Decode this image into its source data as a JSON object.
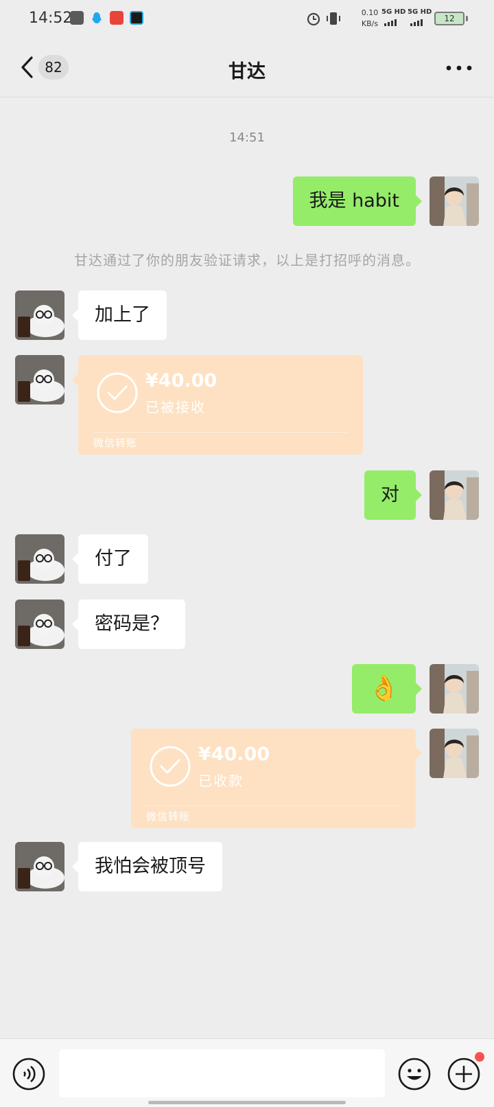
{
  "status_bar": {
    "time": "14:52",
    "net_speed": "0.10",
    "net_unit": "KB/s",
    "sim1": "5G HD",
    "sim2": "5G HD",
    "battery": "12"
  },
  "nav": {
    "unread_count": "82",
    "title": "甘达"
  },
  "chat": {
    "timestamp": "14:51",
    "msg_intro": "我是 habit",
    "system_note": "甘达通过了你的朋友验证请求，以上是打招呼的消息。",
    "msg_added": "加上了",
    "transfer_received": {
      "amount": "¥40.00",
      "status": "已被接收",
      "footer": "微信转账"
    },
    "msg_yes": "对",
    "msg_paid": "付了",
    "msg_password": "密码是？",
    "msg_ok_emoji": "👌",
    "transfer_collected": {
      "amount": "¥40.00",
      "status": "已收款",
      "footer": "微信转账"
    },
    "msg_worry": "我怕会被顶号"
  },
  "input": {
    "value": "",
    "placeholder": ""
  },
  "colors": {
    "background": "#ededed",
    "bubble_sent": "#95ec69",
    "bubble_received": "#ffffff",
    "transfer_card": "#fde1c2",
    "badge_dot": "#fa5151"
  },
  "icons": [
    "back-chevron-icon",
    "more-icon",
    "check-circle-icon",
    "voice-icon",
    "emoji-icon",
    "plus-icon"
  ]
}
